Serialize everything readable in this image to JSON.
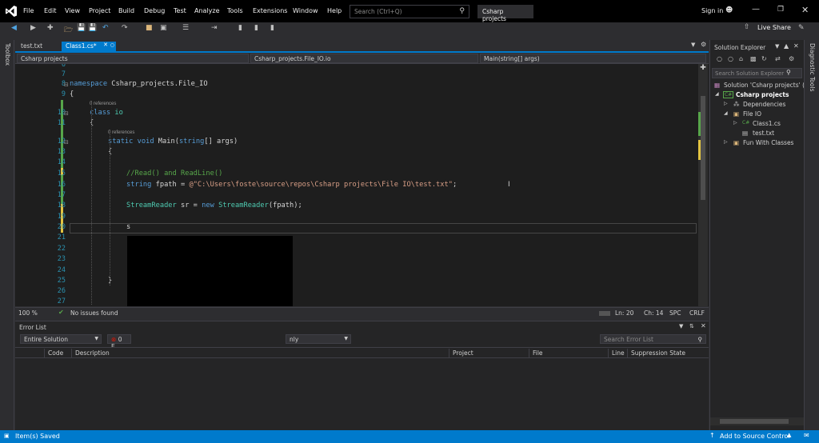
{
  "titlebar": {
    "menus": [
      "File",
      "Edit",
      "View",
      "Project",
      "Build",
      "Debug",
      "Test",
      "Analyze",
      "Tools",
      "Extensions",
      "Window",
      "Help"
    ],
    "search_placeholder": "Search (Ctrl+Q)",
    "solution_title": "Csharp projects",
    "sign_in": "Sign in"
  },
  "toolbar": {
    "live_share": "Live Share"
  },
  "side": {
    "left_label": "Toolbox",
    "right_label": "Diagnostic Tools"
  },
  "tabs": [
    {
      "label": "test.txt"
    },
    {
      "label": "Class1.cs*"
    }
  ],
  "navbar": {
    "project": "Csharp projects",
    "namespace": "Csharp_projects.File_IO.io",
    "member": "Main(string[] args)"
  },
  "editor": {
    "refs": "0 references",
    "line_numbers": [
      "6",
      "7",
      "8",
      "9",
      "",
      "10",
      "11",
      "",
      "12",
      "13",
      "14",
      "15",
      "16",
      "17",
      "18",
      "19",
      "20",
      "21",
      "22",
      "23",
      "24",
      "25",
      "26",
      "27"
    ],
    "cursor_text": "s"
  },
  "editor_status": {
    "zoom": "100 %",
    "issues": "No issues found",
    "line": "Ln: 20",
    "col": "Ch: 14",
    "spc": "SPC",
    "eol": "CRLF"
  },
  "error_list": {
    "title": "Error List",
    "scope": "Entire Solution",
    "errors_badge": "0 E",
    "only": "nly",
    "search_placeholder": "Search Error List",
    "columns": [
      "Code",
      "Description",
      "Project",
      "File",
      "Line",
      "Suppression State"
    ]
  },
  "solution_explorer": {
    "title": "Solution Explorer",
    "search_placeholder": "Search Solution Explorer",
    "items": [
      {
        "label": "Solution 'Csharp projects' (",
        "indent": 0
      },
      {
        "label": "Csharp projects",
        "indent": 1
      },
      {
        "label": "Dependencies",
        "indent": 2
      },
      {
        "label": "File IO",
        "indent": 2
      },
      {
        "label": "Class1.cs",
        "indent": 3
      },
      {
        "label": "test.txt",
        "indent": 3
      },
      {
        "label": "Fun With Classes",
        "indent": 2
      }
    ]
  },
  "statusbar": {
    "left": "Item(s) Saved",
    "source_control": "Add to Source Control"
  }
}
